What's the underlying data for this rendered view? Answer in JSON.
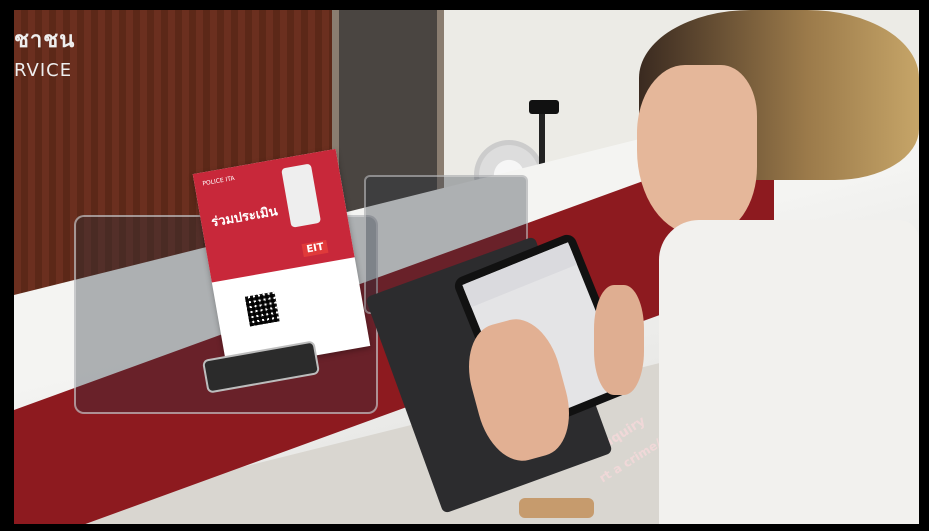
{
  "wall_sign": {
    "line1": "ชาชน",
    "line2": "RVICE"
  },
  "tent_card": {
    "logo": "POLICE ITA",
    "title": "ร่วมประเมิน",
    "badge": "EIT"
  },
  "counter_text": {
    "line1": "e Inquiry",
    "line2": "rt a crime/to"
  }
}
